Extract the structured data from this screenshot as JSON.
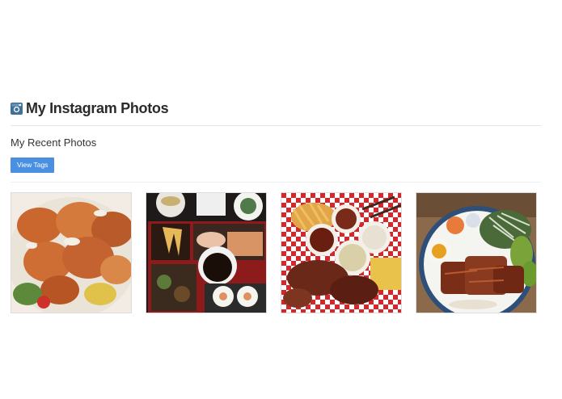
{
  "header": {
    "title": "My Instagram Photos",
    "icon": "instagram-icon"
  },
  "section": {
    "subtitle": "My Recent Photos",
    "button_label": "View Tags"
  },
  "colors": {
    "accent": "#4a90e2",
    "icon": "#3f729b"
  },
  "photos": [
    {
      "name": "fried-seafood-salad-photo"
    },
    {
      "name": "bento-box-photo"
    },
    {
      "name": "bbq-platter-photo"
    },
    {
      "name": "eel-rice-bowl-photo"
    }
  ]
}
